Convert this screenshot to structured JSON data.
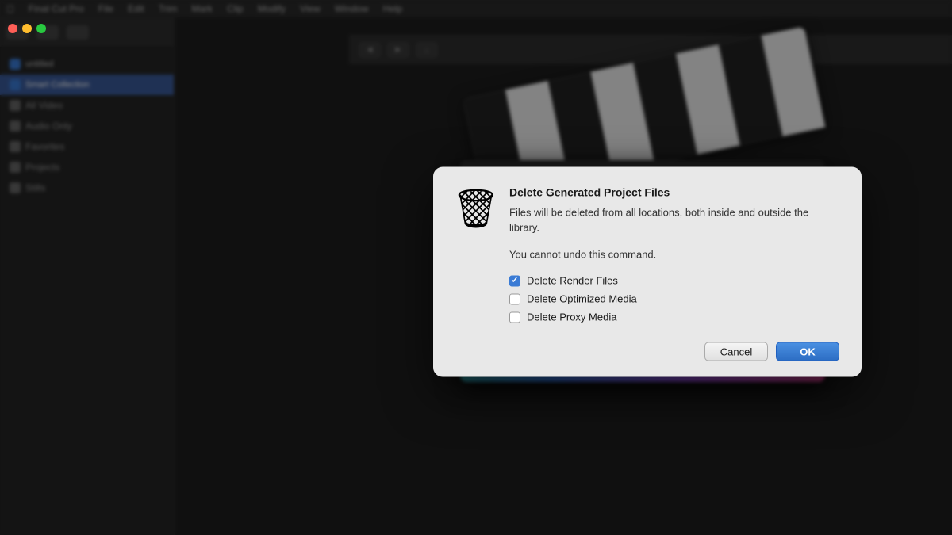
{
  "app": {
    "title": "Final Cut Pro",
    "menu_items": [
      "Final Cut Pro",
      "File",
      "Edit",
      "Trim",
      "Mark",
      "Clip",
      "Modify",
      "View",
      "Window",
      "Help"
    ]
  },
  "window_controls": {
    "close": "close",
    "minimize": "minimize",
    "maximize": "maximize"
  },
  "sidebar": {
    "items": [
      {
        "label": "All Video",
        "active": false
      },
      {
        "label": "Audio Only",
        "active": false
      },
      {
        "label": "Favorites",
        "active": false
      },
      {
        "label": "Projects",
        "active": false
      },
      {
        "label": "Stills",
        "active": false
      }
    ]
  },
  "dialog": {
    "title": "Delete Generated Project Files",
    "description": "Files will be deleted from all locations, both inside and outside the library.",
    "warning": "You cannot undo this command.",
    "checkboxes": [
      {
        "id": "render",
        "label": "Delete Render Files",
        "checked": true
      },
      {
        "id": "optimized",
        "label": "Delete Optimized Media",
        "checked": false
      },
      {
        "id": "proxy",
        "label": "Delete Proxy Media",
        "checked": false
      }
    ],
    "cancel_label": "Cancel",
    "ok_label": "OK"
  }
}
